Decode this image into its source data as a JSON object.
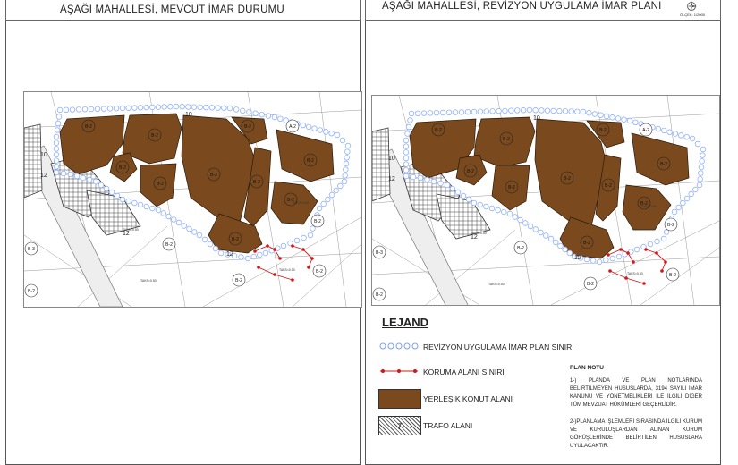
{
  "left_panel": {
    "title": "AŞAĞI MAHALLESİ, MEVCUT İMAR DURUMU"
  },
  "right_panel": {
    "title": "AŞAĞI MAHALLESİ, REVİZYON UYGULAMA İMAR PLANI",
    "scale_label": "ÖLÇEK: 1/2000"
  },
  "map_labels": {
    "zone_b2": "B-2",
    "zone_b3": "B-3",
    "zone_a2": "A-2",
    "height_12": "12",
    "height_10": "10",
    "taks": "TAKS=0.50"
  },
  "colors": {
    "residential": "#7a4a1e",
    "boundary_circle": "#8fb0ff",
    "protection": "#d01818",
    "road_line": "#999999"
  },
  "legend": {
    "title": "LEJAND",
    "items": [
      {
        "label": "REVİZYON UYGULAMA İMAR PLAN SINIRI",
        "icon": "blue-circle-boundary-icon"
      },
      {
        "label": "KORUMA ALANI SINIRI",
        "icon": "red-dot-line-icon"
      },
      {
        "label": "YERLEŞİK KONUT ALANI",
        "icon": "brown-fill-icon"
      },
      {
        "label": "TRAFO ALANI",
        "icon": "hatched-box-icon"
      }
    ]
  },
  "plan_note": {
    "title": "PLAN NOTU",
    "lines": [
      "1-) PLANDA VE PLAN NOTLARINDA BELİRTİLMEYEN HUSUSLARDA, 3194 SAYILI İMAR KANUNU VE YÖNETMELİKLERİ İLE İLGİLİ DİĞER TÜM MEVZUAT HÜKÜMLERİ GEÇERLİDİR.",
      "2-)PLANLAMA İŞLEMLERİ SIRASINDA İLGİLİ KURUM VE KURULUŞLARDAN ALINAN KURUM GÖRÜŞLERİNDE BELİRTİLEN HUSUSLARA UYULACAKTIR."
    ]
  }
}
